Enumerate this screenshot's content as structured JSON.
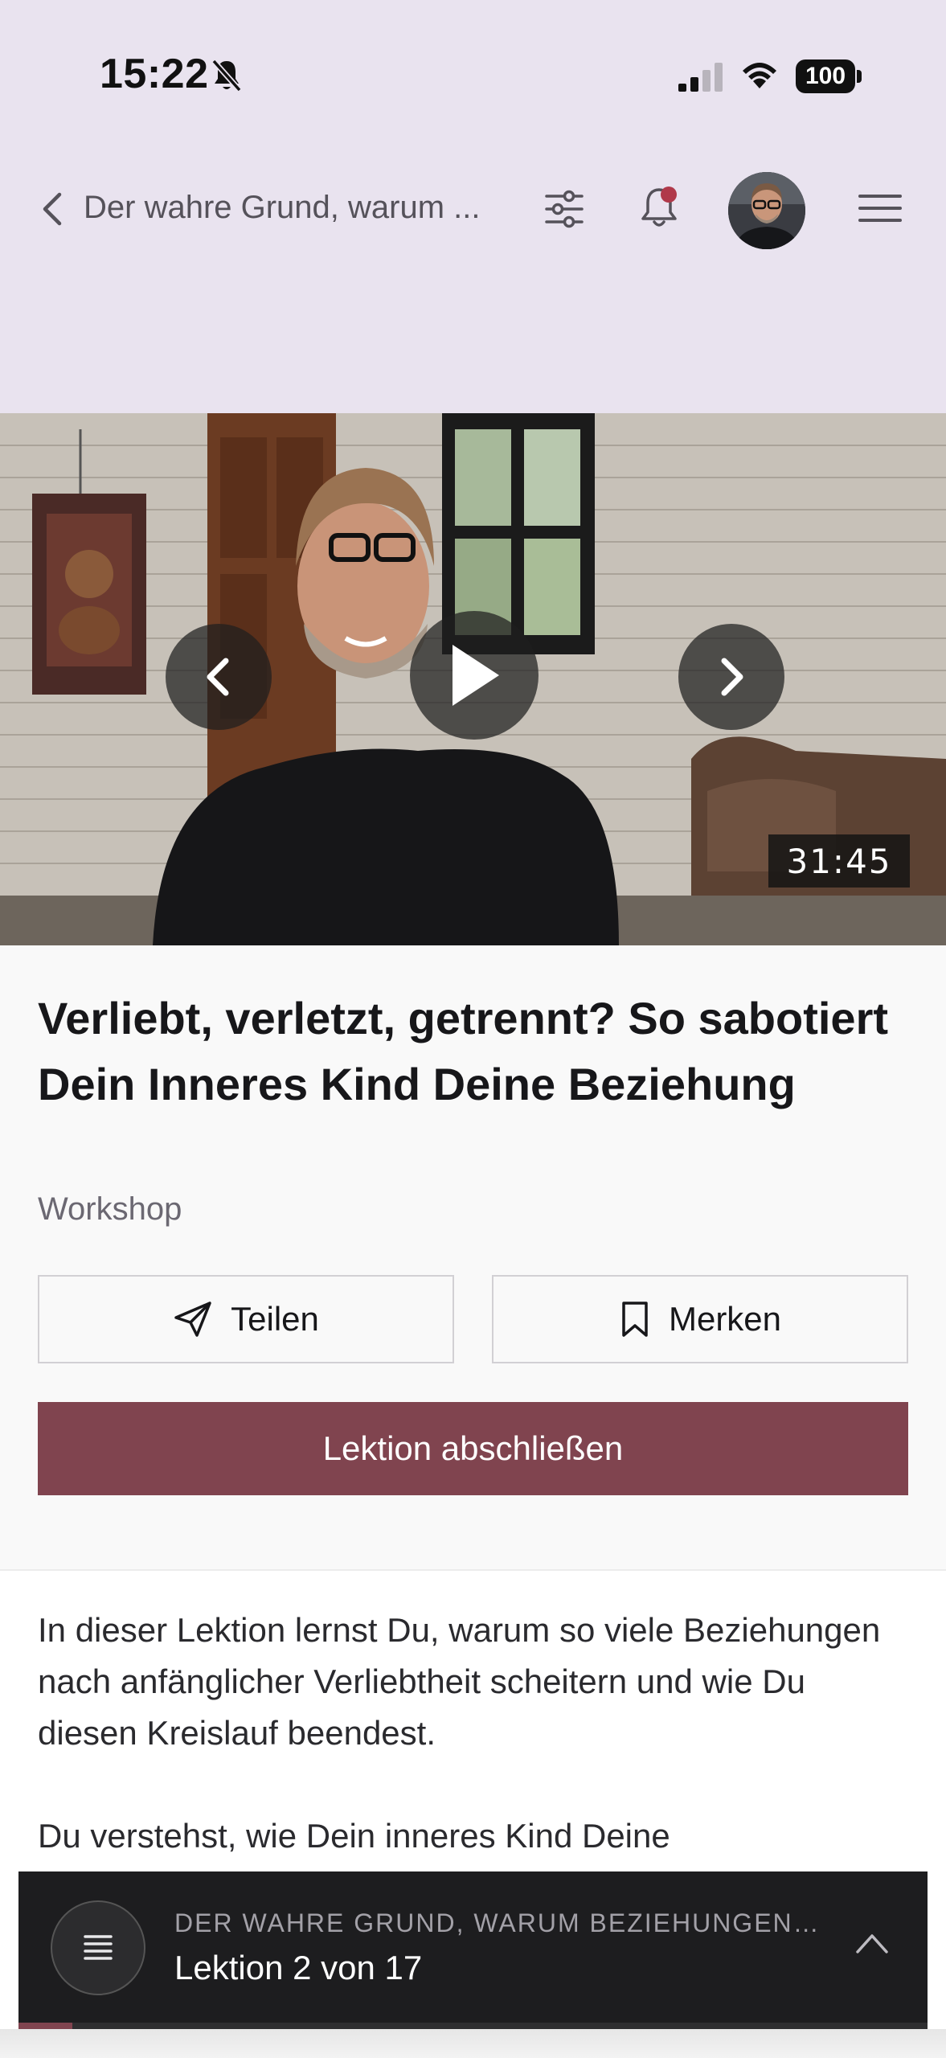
{
  "status_bar": {
    "time": "15:22",
    "battery": "100",
    "icons": [
      "bell-slash-icon",
      "cellular-signal-icon",
      "wifi-icon",
      "battery-icon"
    ]
  },
  "nav": {
    "title": "Der wahre Grund, warum ...",
    "icons": [
      "chevron-left-icon",
      "filter-sliders-icon",
      "bell-icon",
      "avatar",
      "hamburger-menu-icon"
    ],
    "notification_dot_color": "#b0394a"
  },
  "video": {
    "duration": "31:45",
    "icons": [
      "chevron-left-icon",
      "play-icon",
      "chevron-right-icon"
    ]
  },
  "lesson": {
    "title": "Verliebt, verletzt, getrennt? So sabotiert Dein Inneres Kind Deine Beziehung",
    "type": "Workshop",
    "share_label": "Teilen",
    "save_label": "Merken",
    "complete_label": "Lektion abschließen",
    "accent_color": "#80444f"
  },
  "description": {
    "paragraph1": "In dieser Lektion lernst Du, warum so viele Beziehungen nach anfänglicher Verliebtheit scheitern und wie Du diesen Kreislauf beendest.",
    "paragraph2": "Du verstehst, wie Dein inneres Kind Deine"
  },
  "bottom_player": {
    "course": "DER WAHRE GRUND, WARUM BEZIEHUNGEN…",
    "lesson": "Lektion 2 von 17",
    "current_lesson": 2,
    "total_lessons": 17
  }
}
